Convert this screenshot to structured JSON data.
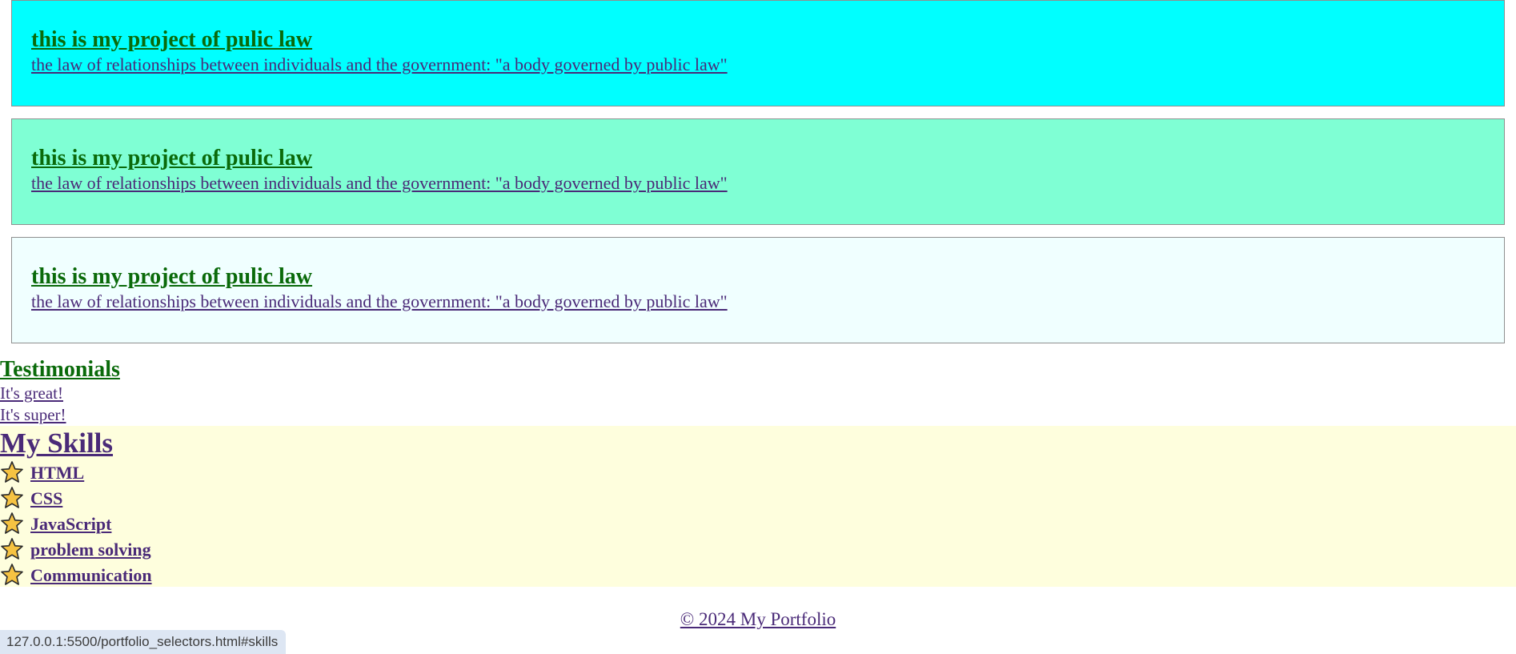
{
  "projects": [
    {
      "title": "this is my project of pulic law",
      "description": "the law of relationships between individuals and the government: \"a body governed by public law\"",
      "background": "#00ffff"
    },
    {
      "title": "this is my project of pulic law",
      "description": "the law of relationships between individuals and the government: \"a body governed by public law\"",
      "background": "#7fffd4"
    },
    {
      "title": "this is my project of pulic law",
      "description": "the law of relationships between individuals and the government: \"a body governed by public law\"",
      "background": "#f0ffff"
    }
  ],
  "testimonials": {
    "title": "Testimonials",
    "items": [
      "It's great!",
      "It's super!"
    ]
  },
  "skills": {
    "title": "My Skills",
    "background": "#fefedd",
    "icon": "star-icon",
    "items": [
      "HTML",
      "CSS",
      "JavaScript",
      "problem solving",
      "Communication"
    ]
  },
  "footer": {
    "text": "© 2024 My Portfolio"
  },
  "status_bar": {
    "url": "127.0.0.1:5500/portfolio_selectors.html#skills"
  }
}
